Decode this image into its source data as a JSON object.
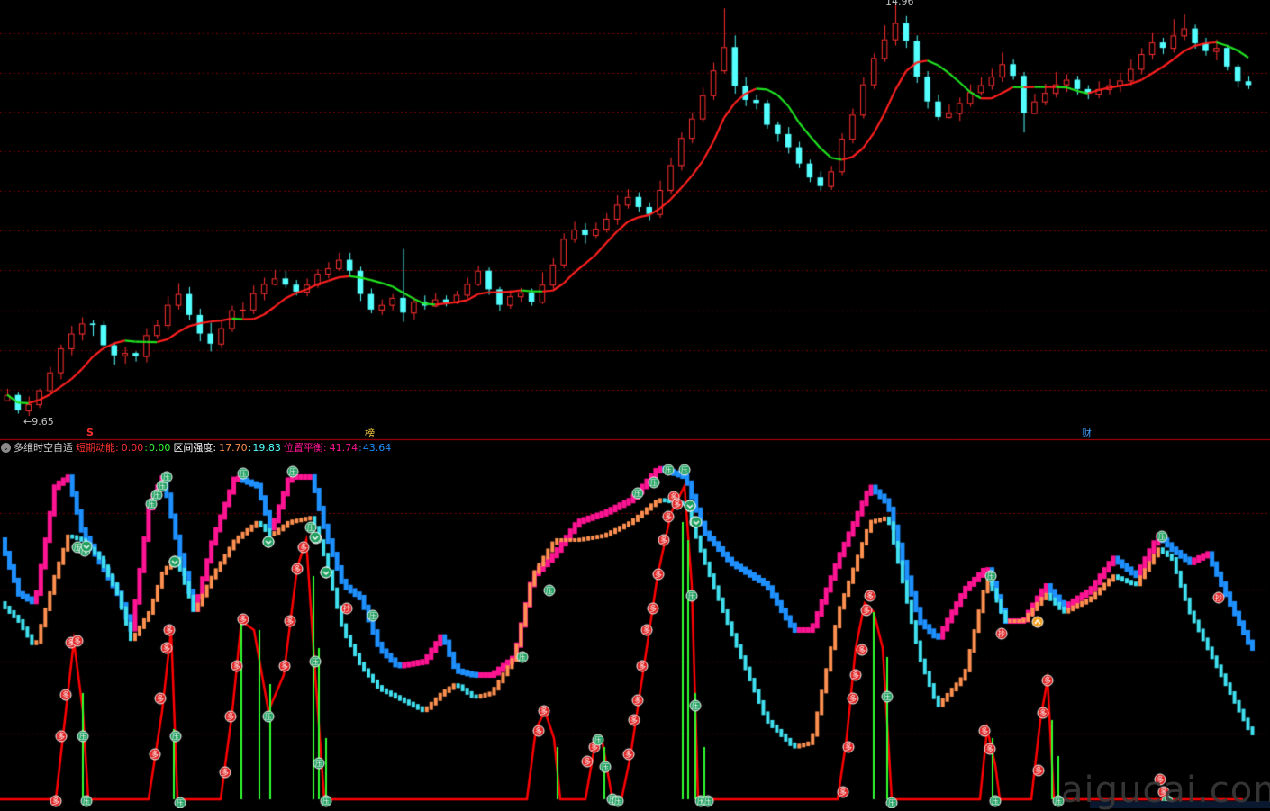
{
  "price_panel": {
    "high_label": "14.96",
    "low_label": "←9.65",
    "markers": [
      {
        "text": "S",
        "color": "#ff3030"
      },
      {
        "text": "榜",
        "color": "#ffd040"
      },
      {
        "text": "财",
        "color": "#40a0ff"
      }
    ]
  },
  "indicator_header": {
    "name": "多维时空自适",
    "short_label": "短期动能:",
    "short_v1": "0.00",
    "short_sep": ":",
    "short_v2": "0.00",
    "range_label": "区间强度:",
    "range_v1": "17.70",
    "range_sep": ":",
    "range_v2": "19.83",
    "pos_label": "位置平衡:",
    "pos_v1": "41.74",
    "pos_sep": ":",
    "pos_v2": "43.64"
  },
  "watermark": "aigucai.com",
  "colors": {
    "up": "#ff3030",
    "down": "#54ffff",
    "ma_up": "#ff2020",
    "ma_down": "#20e020",
    "grid": "#7a0000",
    "pink": "#ff1493",
    "blue": "#1e90ff",
    "cyan": "#40e0f0",
    "orange": "#ff9050",
    "red_line": "#ff0000",
    "green_bar": "#30ff30"
  },
  "chart_data": {
    "type": "candlestick",
    "price_range": [
      9.65,
      14.96
    ],
    "candles": [
      [
        9.85,
        9.92,
        10.0,
        9.85
      ],
      [
        9.92,
        9.72,
        9.95,
        9.68
      ],
      [
        9.72,
        9.8,
        9.9,
        9.65
      ],
      [
        9.8,
        9.98,
        10.0,
        9.75
      ],
      [
        9.98,
        10.21,
        10.28,
        9.93
      ],
      [
        10.21,
        10.52,
        10.57,
        10.12
      ],
      [
        10.52,
        10.71,
        10.81,
        10.43
      ],
      [
        10.71,
        10.84,
        10.92,
        10.62
      ],
      [
        10.84,
        10.82,
        10.88,
        10.68
      ],
      [
        10.82,
        10.56,
        10.87,
        10.51
      ],
      [
        10.56,
        10.43,
        10.59,
        10.31
      ],
      [
        10.43,
        10.46,
        10.54,
        10.32
      ],
      [
        10.46,
        10.42,
        10.48,
        10.35
      ],
      [
        10.42,
        10.69,
        10.78,
        10.34
      ],
      [
        10.69,
        10.82,
        10.89,
        10.64
      ],
      [
        10.82,
        11.08,
        11.19,
        10.75
      ],
      [
        11.08,
        11.22,
        11.36,
        11.02
      ],
      [
        11.22,
        10.95,
        11.31,
        10.88
      ],
      [
        10.95,
        10.71,
        11.03,
        10.61
      ],
      [
        10.71,
        10.58,
        10.85,
        10.48
      ],
      [
        10.58,
        10.78,
        10.87,
        10.52
      ],
      [
        10.78,
        11.01,
        11.07,
        10.73
      ],
      [
        11.01,
        11.02,
        11.11,
        10.91
      ],
      [
        11.02,
        11.23,
        11.33,
        10.96
      ],
      [
        11.23,
        11.35,
        11.43,
        11.14
      ],
      [
        11.35,
        11.42,
        11.53,
        11.33
      ],
      [
        11.42,
        11.34,
        11.52,
        11.3
      ],
      [
        11.34,
        11.25,
        11.4,
        11.2
      ],
      [
        11.25,
        11.34,
        11.42,
        11.19
      ],
      [
        11.34,
        11.48,
        11.54,
        11.3
      ],
      [
        11.48,
        11.55,
        11.63,
        11.42
      ],
      [
        11.55,
        11.66,
        11.75,
        11.52
      ],
      [
        11.66,
        11.52,
        11.75,
        11.44
      ],
      [
        11.52,
        11.22,
        11.57,
        11.13
      ],
      [
        11.22,
        11.02,
        11.29,
        10.97
      ],
      [
        11.02,
        11.08,
        11.15,
        10.95
      ],
      [
        11.08,
        11.17,
        11.22,
        11.01
      ],
      [
        11.17,
        10.98,
        11.8,
        10.86
      ],
      [
        10.98,
        11.12,
        11.18,
        10.89
      ],
      [
        11.12,
        11.07,
        11.2,
        11.02
      ],
      [
        11.07,
        11.15,
        11.23,
        11.05
      ],
      [
        11.15,
        11.11,
        11.2,
        11.06
      ],
      [
        11.11,
        11.21,
        11.26,
        11.09
      ],
      [
        11.21,
        11.35,
        11.43,
        11.17
      ],
      [
        11.35,
        11.52,
        11.58,
        11.32
      ],
      [
        11.52,
        11.28,
        11.56,
        11.21
      ],
      [
        11.28,
        11.08,
        11.31,
        11.0
      ],
      [
        11.08,
        11.19,
        11.27,
        11.03
      ],
      [
        11.19,
        11.24,
        11.3,
        11.11
      ],
      [
        11.24,
        11.12,
        11.29,
        11.07
      ],
      [
        11.12,
        11.34,
        11.5,
        11.09
      ],
      [
        11.34,
        11.6,
        11.68,
        11.29
      ],
      [
        11.6,
        11.93,
        12.0,
        11.55
      ],
      [
        11.93,
        12.05,
        12.15,
        11.88
      ],
      [
        12.05,
        11.98,
        12.13,
        11.87
      ],
      [
        11.98,
        12.06,
        12.14,
        11.94
      ],
      [
        12.06,
        12.19,
        12.26,
        12.01
      ],
      [
        12.19,
        12.37,
        12.49,
        12.11
      ],
      [
        12.37,
        12.47,
        12.57,
        12.32
      ],
      [
        12.47,
        12.34,
        12.53,
        12.28
      ],
      [
        12.34,
        12.25,
        12.4,
        12.17
      ],
      [
        12.25,
        12.56,
        12.68,
        12.2
      ],
      [
        12.56,
        12.88,
        12.98,
        12.5
      ],
      [
        12.88,
        13.23,
        13.3,
        12.81
      ],
      [
        13.23,
        13.48,
        13.56,
        13.16
      ],
      [
        13.48,
        13.78,
        13.88,
        13.43
      ],
      [
        13.78,
        14.1,
        14.2,
        13.72
      ],
      [
        14.1,
        14.4,
        14.9,
        14.06
      ],
      [
        14.4,
        13.9,
        14.55,
        13.8
      ],
      [
        13.9,
        13.72,
        14.01,
        13.64
      ],
      [
        13.72,
        13.68,
        13.79,
        13.6
      ],
      [
        13.68,
        13.4,
        13.72,
        13.35
      ],
      [
        13.4,
        13.28,
        13.44,
        13.18
      ],
      [
        13.28,
        13.11,
        13.37,
        13.03
      ],
      [
        13.11,
        12.9,
        13.18,
        12.84
      ],
      [
        12.9,
        12.72,
        12.95,
        12.66
      ],
      [
        12.72,
        12.61,
        12.8,
        12.55
      ],
      [
        12.61,
        12.8,
        12.87,
        12.56
      ],
      [
        12.8,
        13.22,
        13.29,
        12.75
      ],
      [
        13.22,
        13.53,
        13.61,
        13.16
      ],
      [
        13.53,
        13.92,
        14.01,
        13.48
      ],
      [
        13.92,
        14.26,
        14.32,
        13.86
      ],
      [
        14.26,
        14.5,
        14.68,
        14.21
      ],
      [
        14.5,
        14.71,
        14.96,
        14.42
      ],
      [
        14.71,
        14.48,
        14.8,
        14.39
      ],
      [
        14.48,
        14.02,
        14.55,
        13.94
      ],
      [
        14.02,
        13.7,
        14.09,
        13.61
      ],
      [
        13.7,
        13.5,
        13.79,
        13.46
      ],
      [
        13.5,
        13.55,
        13.66,
        13.48
      ],
      [
        13.55,
        13.68,
        13.75,
        13.45
      ],
      [
        13.68,
        13.82,
        13.92,
        13.63
      ],
      [
        13.82,
        13.91,
        14.01,
        13.78
      ],
      [
        13.91,
        14.02,
        14.12,
        13.85
      ],
      [
        14.02,
        14.18,
        14.33,
        13.95
      ],
      [
        14.18,
        14.03,
        14.24,
        13.98
      ],
      [
        14.03,
        13.55,
        14.08,
        13.3
      ],
      [
        13.55,
        13.7,
        13.8,
        13.6
      ],
      [
        13.7,
        13.81,
        13.93,
        13.65
      ],
      [
        13.81,
        13.92,
        14.08,
        13.75
      ],
      [
        13.92,
        13.98,
        14.05,
        13.82
      ],
      [
        13.98,
        13.86,
        14.03,
        13.79
      ],
      [
        13.86,
        13.8,
        13.91,
        13.73
      ],
      [
        13.8,
        13.86,
        13.96,
        13.74
      ],
      [
        13.86,
        13.91,
        13.99,
        13.79
      ],
      [
        13.91,
        13.97,
        14.07,
        13.82
      ],
      [
        13.97,
        14.12,
        14.24,
        13.9
      ],
      [
        14.12,
        14.31,
        14.39,
        14.05
      ],
      [
        14.31,
        14.46,
        14.58,
        14.24
      ],
      [
        14.46,
        14.39,
        14.52,
        14.31
      ],
      [
        14.39,
        14.55,
        14.76,
        14.33
      ],
      [
        14.55,
        14.64,
        14.82,
        14.49
      ],
      [
        14.64,
        14.45,
        14.69,
        14.38
      ],
      [
        14.45,
        14.35,
        14.52,
        14.29
      ],
      [
        14.35,
        14.39,
        14.5,
        14.23
      ],
      [
        14.39,
        14.15,
        14.43,
        14.1
      ],
      [
        14.15,
        13.96,
        14.18,
        13.88
      ],
      [
        13.96,
        13.91,
        14.03,
        13.86
      ]
    ]
  }
}
